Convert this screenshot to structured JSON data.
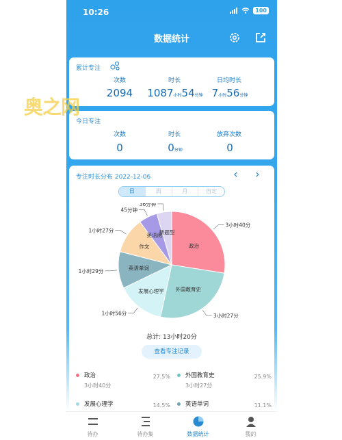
{
  "status": {
    "time": "10:26",
    "battery": "100"
  },
  "header": {
    "title": "数据统计"
  },
  "cumulative": {
    "title": "累计专注",
    "labels": {
      "count": "次数",
      "duration": "时长",
      "daily_avg": "日均时长"
    },
    "count": "2094",
    "duration_h": "1087",
    "duration_h_unit": "小时",
    "duration_m": "54",
    "duration_m_unit": "分钟",
    "avg_h": "7",
    "avg_h_unit": "小时",
    "avg_m": "56",
    "avg_m_unit": "分钟"
  },
  "watermark": "奥之网",
  "today": {
    "title": "今日专注",
    "labels": {
      "count": "次数",
      "duration": "时长",
      "abandon": "放弃次数"
    },
    "count": "0",
    "duration": "0",
    "duration_unit": "分钟",
    "abandon": "0"
  },
  "distribution": {
    "title": "专注时长分布 2022-12-06",
    "prev": "‹",
    "next": "›",
    "segments": [
      "日",
      "周",
      "月",
      "自定"
    ],
    "active_segment": "日",
    "total": "总计: 13小时20分",
    "records_button": "查看专注记录"
  },
  "chart_data": {
    "type": "pie",
    "slices": [
      {
        "name": "政治",
        "duration": "3小时40分",
        "minutes": 220,
        "percent": 27.5,
        "color": "#fb8a9b"
      },
      {
        "name": "外国教育史",
        "duration": "3小时27分",
        "minutes": 207,
        "percent": 25.9,
        "color": "#9fd6d6"
      },
      {
        "name": "发展心理学",
        "duration": "1小时56分",
        "minutes": 116,
        "percent": 14.5,
        "color": "#d3f3f6"
      },
      {
        "name": "英语单词",
        "duration": "1小时29分",
        "minutes": 89,
        "percent": 11.1,
        "color": "#8ab4c0"
      },
      {
        "name": "作文",
        "duration": "1小时27分",
        "minutes": 87,
        "percent": 10.9,
        "color": "#fbd6a8"
      },
      {
        "name": "英语阅读",
        "duration": "45分钟",
        "minutes": 45,
        "percent": 5.6,
        "color": "#a699e6"
      },
      {
        "name": "新题型",
        "duration": "36分钟",
        "minutes": 36,
        "percent": 4.5,
        "color": "#dcd6f3"
      }
    ]
  },
  "legend_rows": [
    {
      "name": "政治",
      "duration": "3小时40分",
      "percent": "27.5%",
      "color": "#fb6e86"
    },
    {
      "name": "外国教育史",
      "duration": "3小时27分",
      "percent": "25.9%",
      "color": "#6cc7c4"
    },
    {
      "name": "发展心理学",
      "duration": "",
      "percent": "14.5%",
      "color": "#9ddde6"
    },
    {
      "name": "英语单词",
      "duration": "",
      "percent": "11.1%",
      "color": "#6fa2b3"
    }
  ],
  "tabs": [
    {
      "label": "待办",
      "icon": "todo-list-icon"
    },
    {
      "label": "待办集",
      "icon": "todo-collection-icon"
    },
    {
      "label": "数据统计",
      "icon": "statistics-pie-icon"
    },
    {
      "label": "我的",
      "icon": "profile-icon"
    }
  ]
}
